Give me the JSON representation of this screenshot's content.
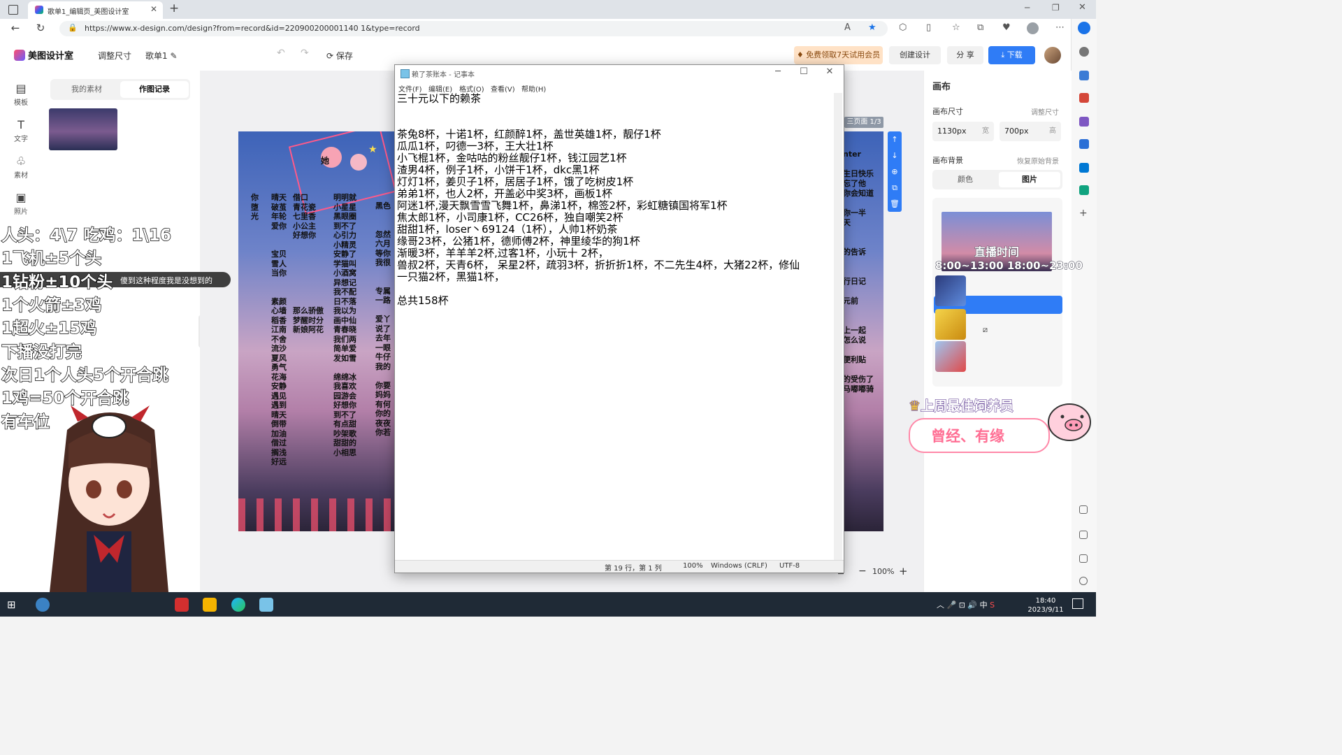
{
  "browser": {
    "tab_title": "歌单1_编辑页_美图设计室",
    "url": "https://www.x-design.com/design?from=record&id=220900200001140 1&type=record"
  },
  "app": {
    "logo": "美图设计室",
    "resize": "调整尺寸",
    "doc_name": "歌单1",
    "save": "保存",
    "vip_promo": "免费领取7天试用会员",
    "create": "创建设计",
    "share": "分 享",
    "download": "下载"
  },
  "left_tools": [
    {
      "label": "模板",
      "icon": "template-icon"
    },
    {
      "label": "文字",
      "icon": "text-icon"
    },
    {
      "label": "素材",
      "icon": "material-icon"
    },
    {
      "label": "照片",
      "icon": "photo-icon"
    }
  ],
  "material_panel": {
    "tab_mine": "我的素材",
    "tab_records": "作图记录"
  },
  "poster": {
    "star_label": "她",
    "cols": [
      "你\n堕\n光",
      "晴天\n破茧\n年轮\n爱你\n\n\n宝贝\n雪人\n当你\n\n\n素颜\n心墙\n稻香\n江南\n不舍\n流沙\n夏风\n勇气\n花海\n安静\n遇见\n遇到\n晴天\n倒带\n加油\n借过\n搁浅\n好远",
      "借口\n青花瓷\n七里香\n小公主\n好想你\n\n\n\n\n\n\n\n那么骄傲\n梦醒时分\n新娘阿花",
      "明明就\n小星星\n黑眼圈\n到不了\n心引力\n小精灵\n安静了\n学猫叫\n小酒窝\n异想记\n我不配\n日不落\n我以为\n画中仙\n青春晓\n我们两\n简单爱\n发如雪\n\n绵绵冰\n我喜欢\n园游会\n好想你\n到不了\n有点甜\n吵架歌\n甜甜的\n小相思",
      "黑色\n\n\n忽然\n六月\n等你\n我很\n\n\n专属\n一路\n\n爱丫\n说了\n去年\n一眼\n牛仔\n我的\n\n你要\n妈妈\n有何\n你的\n夜夜\n你若"
    ],
    "right_fragments": "nter\n\n生日快乐\n忘了他\n你会知道\n\n你一半\n天\n\n\n的告诉\n\n\n行日记\n\n元前\n\n\n上一起\n怎么说\n\n便利贴\n\n的受伤了\n马嘟嘟骑"
  },
  "canvas": {
    "page_badge": "三页面 1/3",
    "zoom": "100%"
  },
  "properties": {
    "title": "画布",
    "size_label": "画布尺寸",
    "resize": "调整尺寸",
    "width": "1130px",
    "width_unit": "宽",
    "height": "700px",
    "height_unit": "高",
    "bg_label": "画布背景",
    "restore_bg": "恢复原始背景",
    "tab_color": "颜色",
    "tab_image": "图片"
  },
  "notepad": {
    "title": "赖了茶账本 - 记事本",
    "menu": [
      "文件(F)",
      "编辑(E)",
      "格式(O)",
      "查看(V)",
      "帮助(H)"
    ],
    "lines": [
      "三十元以下的赖茶",
      "",
      "",
      "茶兔8杯，十诺1杯，红颜醉1杯，盖世英雄1杯，靓仔1杯",
      "瓜瓜1杯，叼德一3杯，王大壮1杯",
      "小飞棍1杯，金咕咕的粉丝靓仔1杯，钱江园艺1杯",
      "渣男4杯，例子1杯，小饼干1杯，dkc黑1杯",
      "灯灯1杯，姜贝子1杯，居居子1杯，饿了吃树皮1杯",
      "弟弟1杯，也人2杯，开盖必中奖3杯，画板1杯",
      "阿迷1杯,漫天飘雪雪飞舞1杯，鼻涕1杯，棉签2杯，彩虹糖镇国将军1杯",
      "焦太郎1杯，小司康1杯，CC26杯，独自嘲笑2杯",
      "甜甜1杯，loser丶69124（1杯），人帅1杯奶茶",
      "缘哥23杯，公猪1杯，德师傅2杯，神里绫华的狗1杯",
      "渐暖3杯，羊羊羊2杯,过客1杯，小玩十 2杯，",
      "兽叔2杯，天青6杯，  呆星2杯，疏羽3杯，折折折1杯，不二先生4杯，大猪22杯，修仙",
      "一只猫2杯，黑猫1杯，",
      "",
      "总共158杯"
    ],
    "status": {
      "pos": "第 19 行，第 1 列",
      "zoom": "100%",
      "eol": "Windows (CRLF)",
      "enc": "UTF-8"
    }
  },
  "overlay": {
    "lines": [
      "人头：4\\7 吃鸡：1\\16",
      "1飞机±5个头",
      "1钻粉±10个头",
      "1个火箭±3鸡",
      "1超火±15鸡",
      "下播没打完",
      "次日1个人头5个开合跳",
      "1鸡=50个开合跳",
      "有车位"
    ],
    "chat_text": "傻到这种程度我是没想到的",
    "live_title": "直播时间",
    "live_time": "8:00~13:00 18:00~23:00",
    "best_fan_title": "上周最佳饲养员",
    "best_fan_name": "曾经、有缘"
  },
  "taskbar": {
    "time": "18:40",
    "date": "2023/9/11",
    "ime": "中"
  }
}
